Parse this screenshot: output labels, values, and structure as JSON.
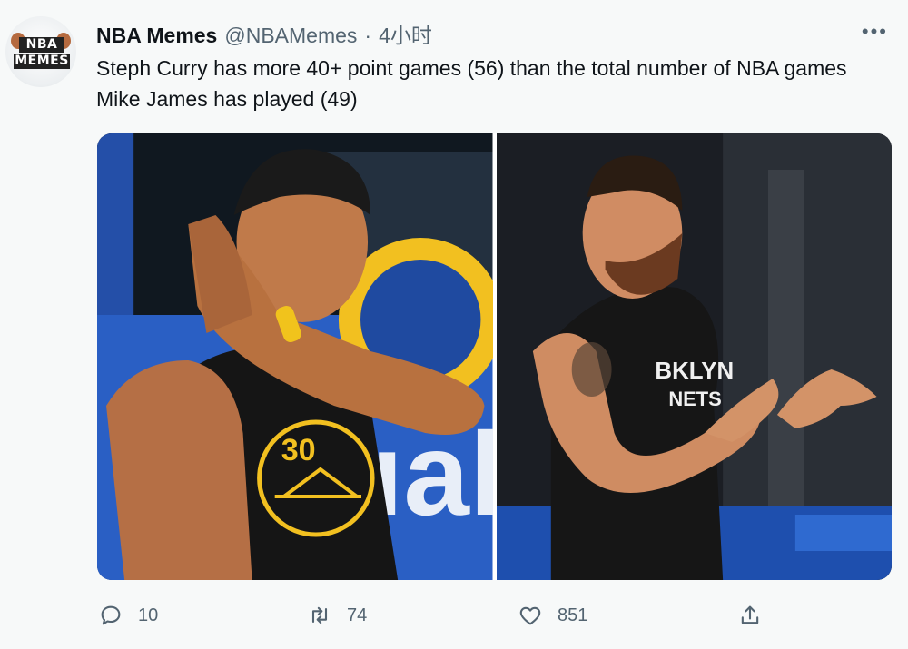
{
  "tweet": {
    "avatar_lines": [
      "NBA",
      "MEMES"
    ],
    "author_name": "NBA Memes",
    "author_handle": "@NBAMemes",
    "separator": "·",
    "timestamp": "4小时",
    "more_label": "•••",
    "text": "Steph Curry has more 40+ point games (56) than the total number of NBA games Mike James has played (49)",
    "images": [
      {
        "jersey_number": "30",
        "description_icon": "curry-photo"
      },
      {
        "jersey_lines": [
          "BKLYN",
          "NETS"
        ],
        "description_icon": "mike-james-photo"
      }
    ]
  },
  "actions": {
    "reply_count": "10",
    "retweet_count": "74",
    "like_count": "851"
  },
  "colors": {
    "accent": "#1d9bf0",
    "muted": "#536471",
    "background": "#f7f9f9"
  }
}
